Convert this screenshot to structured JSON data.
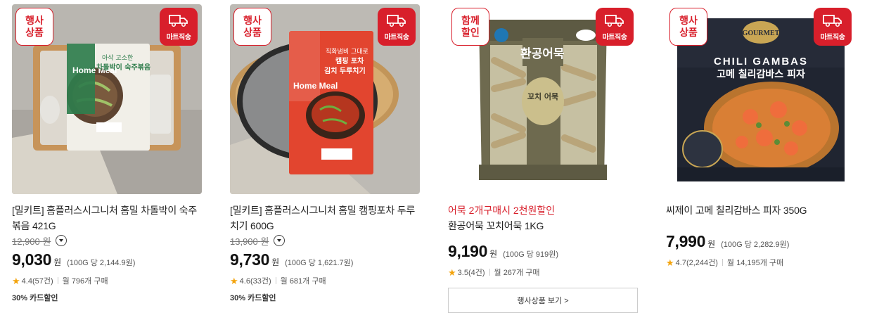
{
  "badges": {
    "delivery_label": "마트직송"
  },
  "products": [
    {
      "promo_badge": "행사\n상품",
      "title": "[밀키트] 홈플러스시그니처 홈밀 차돌박이 숙주볶음 421G",
      "original_price": "12,900",
      "original_price_unit": "원",
      "price": "9,030",
      "price_unit": "원",
      "unit_price": "(100G 당 2,144.9원)",
      "rating": "4.4(57건)",
      "sales": "월 796개 구매",
      "card_discount": "30% 카드할인"
    },
    {
      "promo_badge": "행사\n상품",
      "title": "[밀키트] 홈플러스시그니처 홈밀 캠핑포차 두루치기 600G",
      "original_price": "13,900",
      "original_price_unit": "원",
      "price": "9,730",
      "price_unit": "원",
      "unit_price": "(100G 당 1,621.7원)",
      "rating": "4.6(33건)",
      "sales": "월 681개 구매",
      "card_discount": "30% 카드할인"
    },
    {
      "promo_badge": "함께\n할인",
      "promo_text": "어묵 2개구매시 2천원할인",
      "title": "환공어묵 꼬치어묵 1KG",
      "price": "9,190",
      "price_unit": "원",
      "unit_price": "(100G 당 919원)",
      "rating": "3.5(4건)",
      "sales": "월 267개 구매",
      "more_button": "행사상품 보기 >"
    },
    {
      "promo_badge": "행사\n상품",
      "title": "씨제이 고메 칠리감바스 피자 350G",
      "price": "7,990",
      "price_unit": "원",
      "unit_price": "(100G 당 2,282.9원)",
      "rating": "4.7(2,244건)",
      "sales": "월 14,195개 구매"
    }
  ],
  "package_text": {
    "p0_subtitle": "아삭 고소한",
    "p0_name": "차돌박이 숙주볶음",
    "p0_brand": "Home Meal",
    "p1_line1": "직화냄비 그대로",
    "p1_line2": "캠핑 포차",
    "p1_line3": "김치 두루치기",
    "p1_brand": "Home Meal",
    "p2_name": "환공어묵",
    "p2_label": "꼬치 어묵",
    "p3_brand": "GOURMET",
    "p3_name_en": "CHILI GAMBAS",
    "p3_name_kr": "고메 칠리감바스 피자"
  },
  "colors": {
    "accent": "#d81f2b",
    "star": "#f3a30b",
    "homemeal_green": "#2f7d4c",
    "homemeal_red": "#e2452f"
  }
}
